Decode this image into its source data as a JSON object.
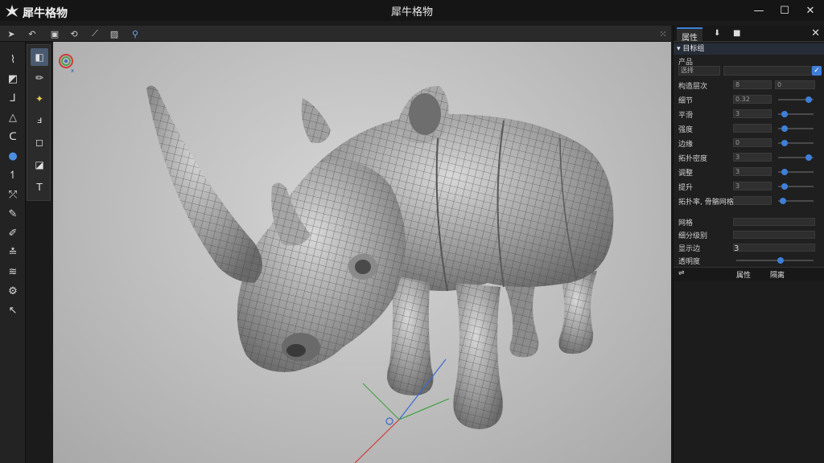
{
  "app": {
    "name": "犀牛格物",
    "window_title": "犀牛格物"
  },
  "window_controls": {
    "minimize": "—",
    "maximize": "☐",
    "close": "✕"
  },
  "top_toolbar": [
    "select-arrow-icon",
    "undo-icon",
    "lock-icon",
    "link-icon",
    "brush-icon",
    "image-icon",
    "zoom-icon"
  ],
  "left_toolbar": [
    "pipe-icon",
    "cube-icon",
    "text-tool-icon",
    "shape-icon",
    "lasso-icon",
    "sphere-icon",
    "hook-icon",
    "measure-icon",
    "paint-icon",
    "pen-icon",
    "ruler-icon",
    "layers-icon",
    "gear-icon",
    "knife-icon"
  ],
  "sub_toolbar": [
    "move-icon",
    "pencil-icon",
    "fill-icon",
    "scale-icon",
    "frame-icon",
    "bucket-icon",
    "type-icon"
  ],
  "panel": {
    "tabs": [
      "属性",
      "⬇",
      "■"
    ],
    "close": "✕",
    "section": "▾ 目标组",
    "mode_label": "产品",
    "mode_field": "选择",
    "mode_check": "✓",
    "rows": [
      {
        "label": "构造层次",
        "field1": "8",
        "field2": "0"
      },
      {
        "label": "细节",
        "field1": "0.32",
        "slider": 0.85
      },
      {
        "label": "平滑",
        "field1": "3",
        "slider": 0.1
      },
      {
        "label": "强度",
        "field1": "",
        "slider": 0.1
      },
      {
        "label": "边缘",
        "field1": "0",
        "slider": 0.1
      },
      {
        "label": "拓扑密度",
        "field1": "3",
        "slider": 0.85
      },
      {
        "label": "调整",
        "field1": "3",
        "slider": 0.1
      },
      {
        "label": "提升",
        "field1": "3",
        "slider": 0.1
      },
      {
        "label": "拓扑率, 骨骼网格",
        "field1": "",
        "slider": 0.05
      }
    ],
    "rows2": [
      {
        "label": "网格",
        "value": ""
      },
      {
        "label": "细分级别",
        "value": ""
      },
      {
        "label": "显示边",
        "value": "3"
      },
      {
        "label": "透明度",
        "slider": 0.55
      }
    ],
    "footer": {
      "left": "⇌",
      "mid": "属性",
      "right": "隔离"
    }
  }
}
